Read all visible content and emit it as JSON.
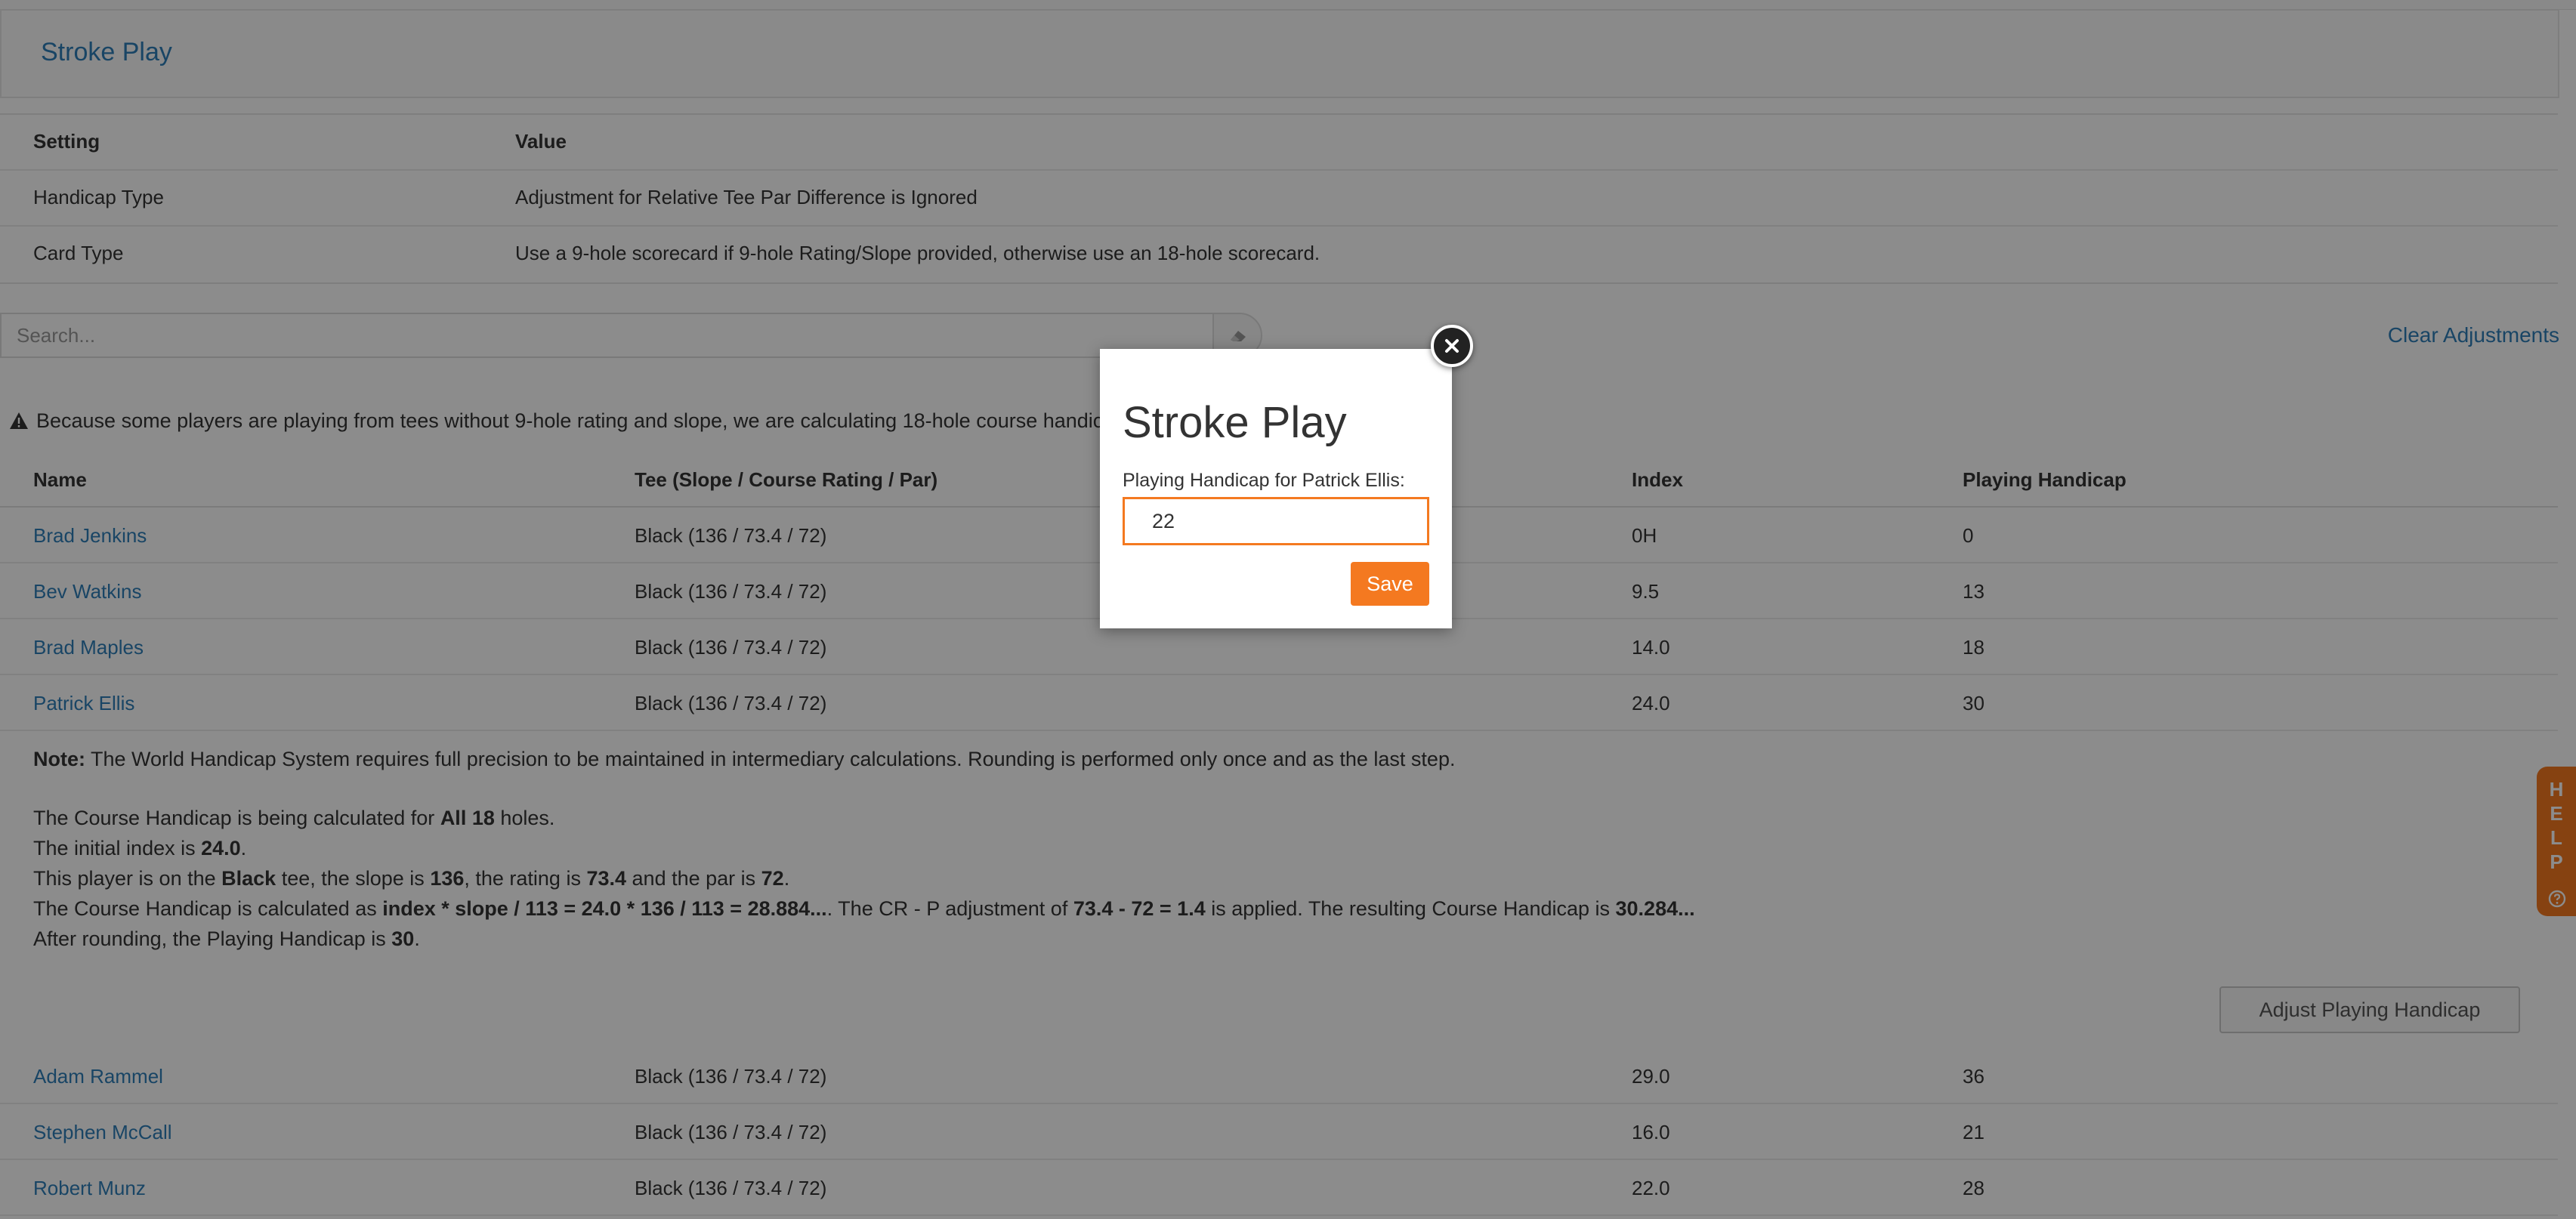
{
  "header": {
    "title": "Stroke Play"
  },
  "settings": {
    "columns": {
      "setting": "Setting",
      "value": "Value"
    },
    "rows": [
      {
        "setting": "Handicap Type",
        "value": "Adjustment for Relative Tee Par Difference is Ignored"
      },
      {
        "setting": "Card Type",
        "value": "Use a 9-hole scorecard if 9-hole Rating/Slope provided, otherwise use an 18-hole scorecard."
      }
    ]
  },
  "search": {
    "placeholder": "Search..."
  },
  "clear_adjustments_label": "Clear Adjustments",
  "warning": {
    "icon": "warning-icon",
    "text": "Because some players are playing from tees without 9-hole rating and slope, we are calculating 18-hole course handicaps for all players."
  },
  "table": {
    "headers": {
      "name": "Name",
      "tee": "Tee (Slope / Course Rating / Par)",
      "index": "Index",
      "playing_handicap": "Playing Handicap"
    },
    "rows": [
      {
        "name": "Brad Jenkins",
        "tee": "Black (136 / 73.4 / 72)",
        "index": "0H",
        "playing_handicap": "0"
      },
      {
        "name": "Bev Watkins",
        "tee": "Black (136 / 73.4 / 72)",
        "index": "9.5",
        "playing_handicap": "13"
      },
      {
        "name": "Brad Maples",
        "tee": "Black (136 / 73.4 / 72)",
        "index": "14.0",
        "playing_handicap": "18"
      },
      {
        "name": "Patrick Ellis",
        "tee": "Black (136 / 73.4 / 72)",
        "index": "24.0",
        "playing_handicap": "30"
      },
      {
        "name": "Adam Rammel",
        "tee": "Black (136 / 73.4 / 72)",
        "index": "29.0",
        "playing_handicap": "36"
      },
      {
        "name": "Stephen McCall",
        "tee": "Black (136 / 73.4 / 72)",
        "index": "16.0",
        "playing_handicap": "21"
      },
      {
        "name": "Robert Munz",
        "tee": "Black (136 / 73.4 / 72)",
        "index": "22.0",
        "playing_handicap": "28"
      }
    ]
  },
  "detail": {
    "note_label": "Note:",
    "note_text": " The World Handicap System requires full precision to be maintained in intermediary calculations. Rounding is performed only once and as the last step.",
    "holes_pre": "The Course Handicap is being calculated for ",
    "holes_bold1": "All 18",
    "holes_post": " holes.",
    "index_pre": "The initial index is ",
    "index_val": "24.0",
    "index_post": ".",
    "tee_pre": "This player is on the ",
    "tee_name": "Black",
    "tee_mid1": " tee, the slope is ",
    "tee_slope": "136",
    "tee_mid2": ", the rating is ",
    "tee_rating": "73.4",
    "tee_mid3": " and the par is ",
    "tee_par": "72",
    "tee_post": ".",
    "calc_pre": "The Course Handicap is calculated as ",
    "calc_formula": "index * slope / 113 = 24.0 * 136 / 113 = 28.884...",
    "calc_mid1": ". The CR - P adjustment of ",
    "calc_adj": "73.4 - 72 = 1.4",
    "calc_mid2": " is applied. The resulting Course Handicap is ",
    "calc_result": "30.284...",
    "round_pre": "After rounding, the Playing Handicap is ",
    "round_val": "30",
    "round_post": ".",
    "adjust_button": "Adjust Playing Handicap"
  },
  "help_tab": {
    "letters": [
      "H",
      "E",
      "L",
      "P"
    ],
    "icon": "question-circle-icon"
  },
  "modal": {
    "title": "Stroke Play",
    "label": "Playing Handicap for Patrick Ellis:",
    "input_value": "22",
    "save_label": "Save",
    "close_icon": "close-icon"
  },
  "colors": {
    "accent": "#f47920",
    "link": "#2e7eb8",
    "overlay": "rgba(0,0,0,0.45)"
  }
}
